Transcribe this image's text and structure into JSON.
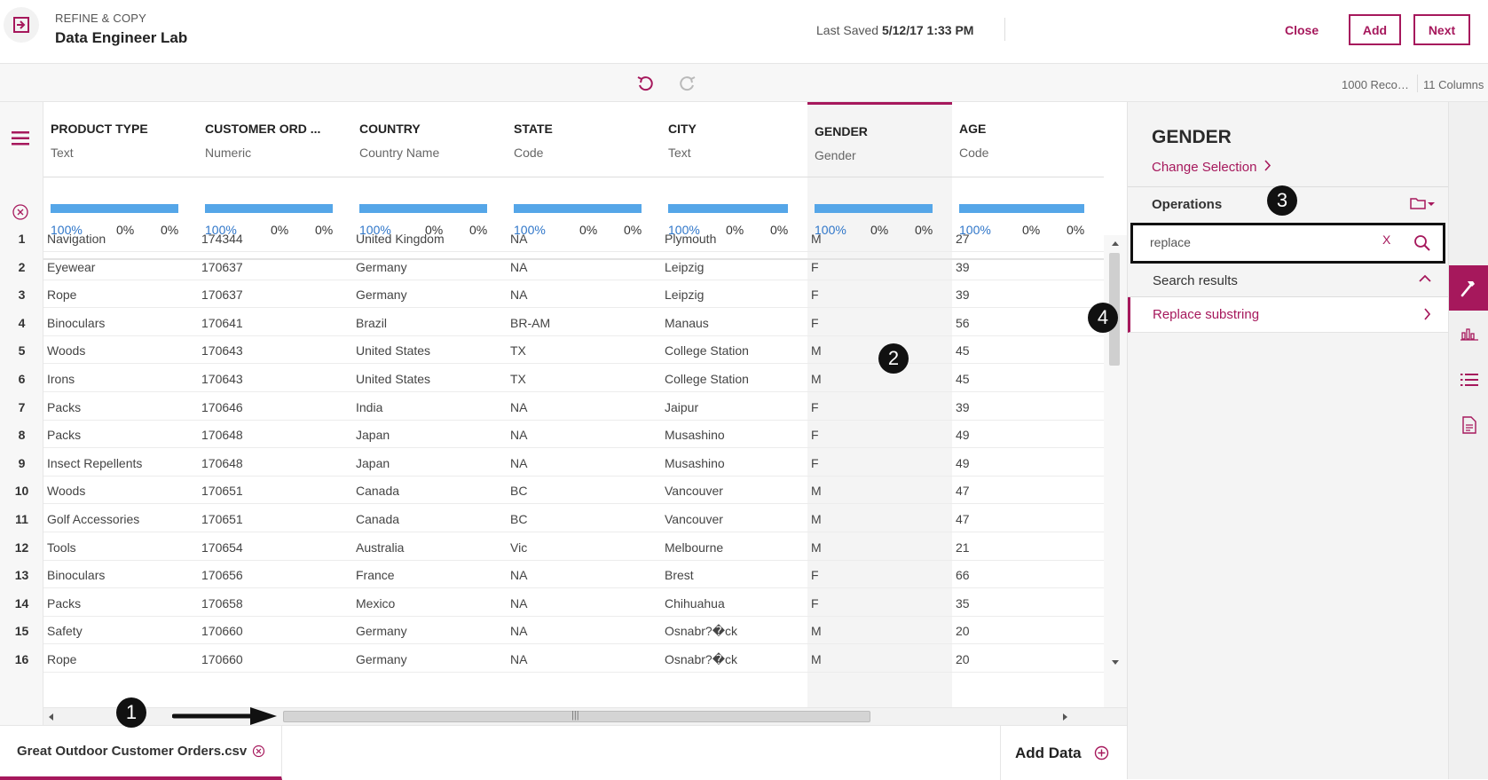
{
  "header": {
    "kicker": "REFINE & COPY",
    "title": "Data Engineer Lab",
    "last_saved_label": "Last Saved",
    "last_saved_value": "5/12/17 1:33 PM",
    "close_label": "Close",
    "add_label": "Add",
    "next_label": "Next"
  },
  "toolbar": {
    "record_count": "1000 Reco…",
    "column_count": "11 Columns"
  },
  "grid": {
    "columns": [
      {
        "name": "PRODUCT TYPE",
        "type": "Text",
        "quality": [
          "100%",
          "0%",
          "0%"
        ]
      },
      {
        "name": "CUSTOMER ORD ...",
        "type": "Numeric",
        "quality": [
          "100%",
          "0%",
          "0%"
        ]
      },
      {
        "name": "COUNTRY",
        "type": "Country Name",
        "quality": [
          "100%",
          "0%",
          "0%"
        ]
      },
      {
        "name": "STATE",
        "type": "Code",
        "quality": [
          "100%",
          "0%",
          "0%"
        ]
      },
      {
        "name": "CITY",
        "type": "Text",
        "quality": [
          "100%",
          "0%",
          "0%"
        ]
      },
      {
        "name": "GENDER",
        "type": "Gender",
        "quality": [
          "100%",
          "0%",
          "0%"
        ]
      },
      {
        "name": "AGE",
        "type": "Code",
        "quality": [
          "100%",
          "0%",
          "0%"
        ]
      }
    ],
    "row_numbers": [
      "1",
      "2",
      "3",
      "4",
      "5",
      "6",
      "7",
      "8",
      "9",
      "10",
      "11",
      "12",
      "13",
      "14",
      "15",
      "16"
    ],
    "rows": [
      [
        "Navigation",
        "174344",
        "United Kingdom",
        "NA",
        "Plymouth",
        "M",
        "27"
      ],
      [
        "Eyewear",
        "170637",
        "Germany",
        "NA",
        "Leipzig",
        "F",
        "39"
      ],
      [
        "Rope",
        "170637",
        "Germany",
        "NA",
        "Leipzig",
        "F",
        "39"
      ],
      [
        "Binoculars",
        "170641",
        "Brazil",
        "BR-AM",
        "Manaus",
        "F",
        "56"
      ],
      [
        "Woods",
        "170643",
        "United States",
        "TX",
        "College Station",
        "M",
        "45"
      ],
      [
        "Irons",
        "170643",
        "United States",
        "TX",
        "College Station",
        "M",
        "45"
      ],
      [
        "Packs",
        "170646",
        "India",
        "NA",
        "Jaipur",
        "F",
        "39"
      ],
      [
        "Packs",
        "170648",
        "Japan",
        "NA",
        "Musashino",
        "F",
        "49"
      ],
      [
        "Insect Repellents",
        "170648",
        "Japan",
        "NA",
        "Musashino",
        "F",
        "49"
      ],
      [
        "Woods",
        "170651",
        "Canada",
        "BC",
        "Vancouver",
        "M",
        "47"
      ],
      [
        "Golf Accessories",
        "170651",
        "Canada",
        "BC",
        "Vancouver",
        "M",
        "47"
      ],
      [
        "Tools",
        "170654",
        "Australia",
        "Vic",
        "Melbourne",
        "M",
        "21"
      ],
      [
        "Binoculars",
        "170656",
        "France",
        "NA",
        "Brest",
        "F",
        "66"
      ],
      [
        "Packs",
        "170658",
        "Mexico",
        "NA",
        "Chihuahua",
        "F",
        "35"
      ],
      [
        "Safety",
        "170660",
        "Germany",
        "NA",
        "Osnabr?�ck",
        "M",
        "20"
      ],
      [
        "Rope",
        "170660",
        "Germany",
        "NA",
        "Osnabr?�ck",
        "M",
        "20"
      ]
    ]
  },
  "tabs": {
    "file_label": "Great Outdoor Customer Orders.csv",
    "add_data_label": "Add Data"
  },
  "panel": {
    "title": "GENDER",
    "change_selection": "Change Selection",
    "operations_label": "Operations",
    "search_value": "replace",
    "search_clear": "X",
    "results_label": "Search results",
    "result_item": "Replace substring"
  },
  "annotations": [
    "1",
    "2",
    "3",
    "4"
  ],
  "colors": {
    "accent": "#a6185c",
    "quality_bar": "#55a6e8",
    "valid_text": "#2f76c9"
  }
}
